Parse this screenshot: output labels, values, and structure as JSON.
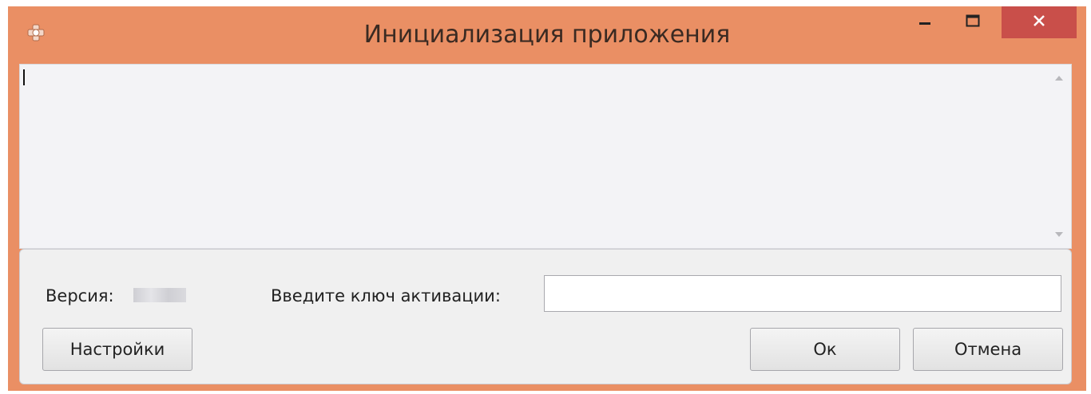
{
  "window": {
    "title": "Инициализация приложения",
    "accent_color": "#ea8f64",
    "close_color": "#c94f4a",
    "icons": {
      "app": "app-icon",
      "minimize": "minimize-icon",
      "maximize": "maximize-icon",
      "close": "close-icon"
    }
  },
  "log": {
    "text": ""
  },
  "footer": {
    "version_label": "Версия:",
    "key_label": "Введите ключ активации:",
    "key_value": "",
    "settings_label": "Настройки",
    "ok_label": "Ок",
    "cancel_label": "Отмена"
  }
}
